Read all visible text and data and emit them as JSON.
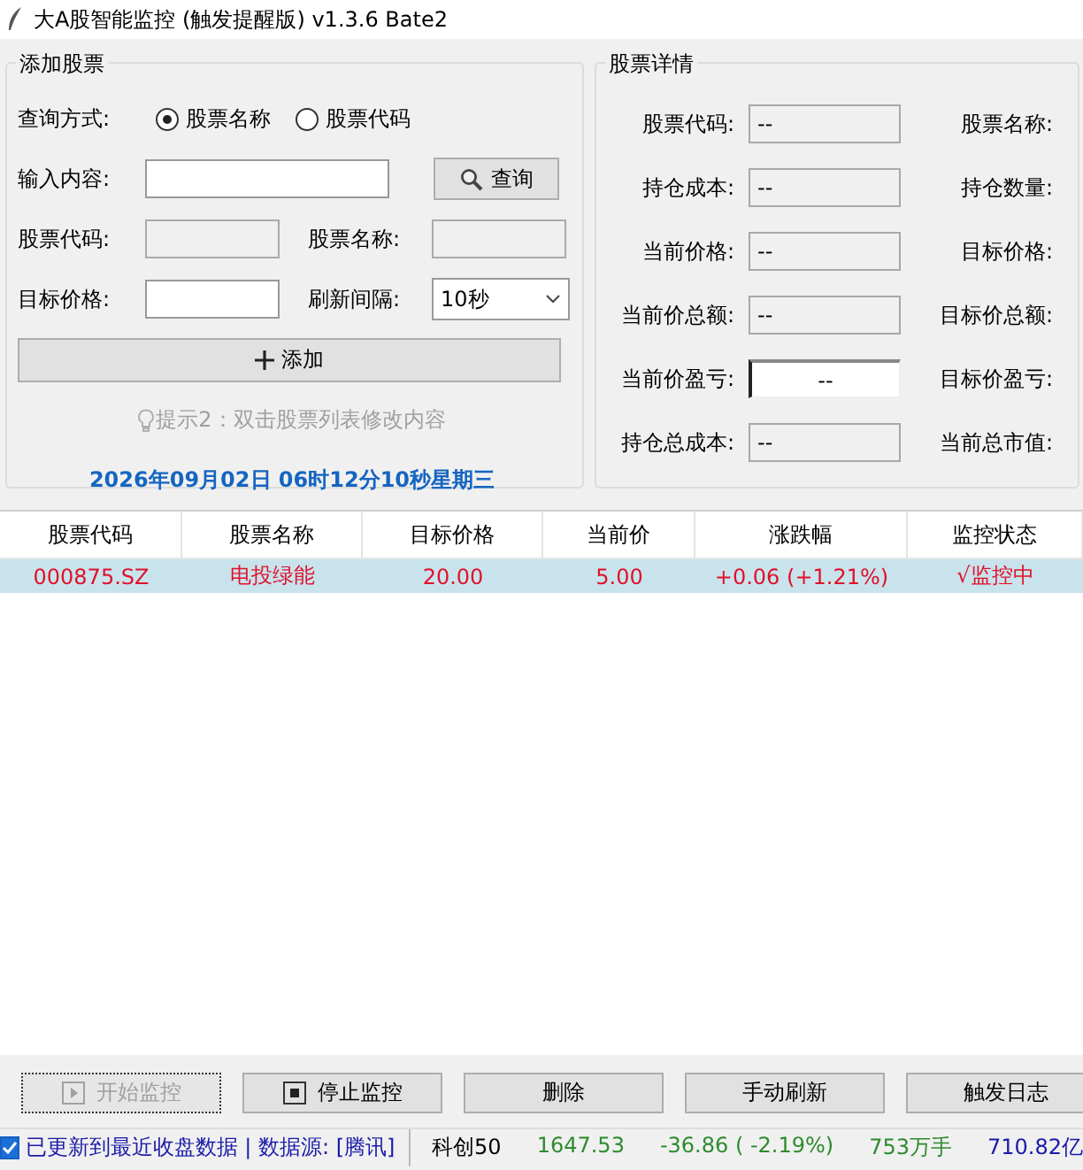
{
  "window": {
    "title": "大A股智能监控 (触发提醒版) v1.3.6 Bate2"
  },
  "add_stock": {
    "title": "添加股票",
    "query_mode": {
      "label": "查询方式:",
      "options": [
        {
          "label": "股票名称",
          "selected": true
        },
        {
          "label": "股票代码",
          "selected": false
        }
      ]
    },
    "input": {
      "label": "输入内容:"
    },
    "query_button": "查询",
    "code": {
      "label": "股票代码:"
    },
    "name": {
      "label": "股票名称:"
    },
    "target": {
      "label": "目标价格:"
    },
    "interval": {
      "label": "刷新间隔:",
      "value": "10秒"
    },
    "add_button": "添加",
    "hint": "提示2：双击股票列表修改内容",
    "datetime": "2026年09月02日 06时12分10秒星期三"
  },
  "details": {
    "title": "股票详情",
    "rows": [
      {
        "label": "股票代码:",
        "value": "--",
        "focused": false,
        "right_label": "股票名称:"
      },
      {
        "label": "持仓成本:",
        "value": "--",
        "focused": false,
        "right_label": "持仓数量:"
      },
      {
        "label": "当前价格:",
        "value": "--",
        "focused": false,
        "right_label": "目标价格:"
      },
      {
        "label": "当前价总额:",
        "value": "--",
        "focused": false,
        "right_label": "目标价总额:"
      },
      {
        "label": "当前价盈亏:",
        "value": "--",
        "focused": true,
        "right_label": "目标价盈亏:"
      },
      {
        "label": "持仓总成本:",
        "value": "--",
        "focused": false,
        "right_label": "当前总市值:"
      }
    ]
  },
  "table": {
    "columns": [
      "股票代码",
      "股票名称",
      "目标价格",
      "当前价",
      "涨跌幅",
      "监控状态"
    ],
    "rows": [
      {
        "selected": true,
        "cells": [
          "000875.SZ",
          "电投绿能",
          "20.00",
          "5.00",
          "+0.06 (+1.21%)",
          "√监控中"
        ]
      }
    ]
  },
  "buttons": [
    {
      "label": "开始监控",
      "kind": "play",
      "disabled": true
    },
    {
      "label": "停止监控",
      "kind": "stop",
      "disabled": false
    },
    {
      "label": "删除",
      "kind": "text",
      "disabled": false
    },
    {
      "label": "手动刷新",
      "kind": "text",
      "disabled": false
    },
    {
      "label": "触发日志",
      "kind": "text",
      "disabled": false
    }
  ],
  "status_bar": {
    "checked": true,
    "message": "已更新到最近收盘数据 | 数据源: [腾讯]",
    "index": [
      {
        "text": "科创50",
        "color": "#000000"
      },
      {
        "text": "1647.53",
        "color": "#2e8b2e"
      },
      {
        "text": "-36.86 ( -2.19%)",
        "color": "#2e8b2e"
      },
      {
        "text": "753万手",
        "color": "#2e8b2e"
      },
      {
        "text": "710.82亿",
        "color": "#1a1aa8"
      }
    ]
  }
}
